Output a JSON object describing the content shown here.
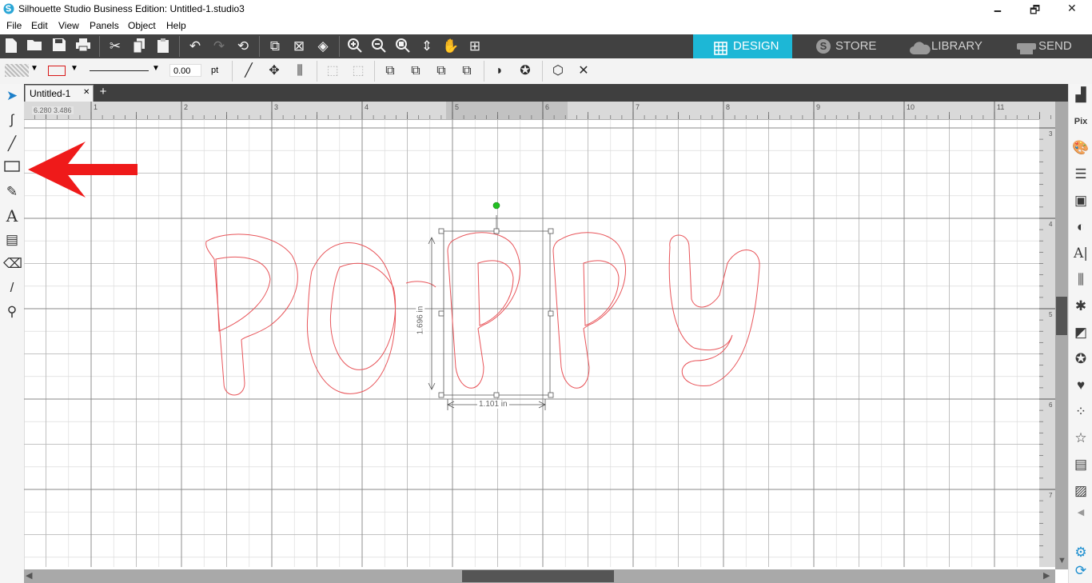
{
  "window": {
    "title": "Silhouette Studio Business Edition: Untitled-1.studio3",
    "minimize": "🗕",
    "restore": "🗗",
    "close": "✕"
  },
  "menu": [
    "File",
    "Edit",
    "View",
    "Panels",
    "Object",
    "Help"
  ],
  "toolbar": {
    "icons": [
      "new-file-icon",
      "open-folder-icon",
      "save-icon",
      "print-icon",
      "cut-icon",
      "copy-icon",
      "paste-icon",
      "undo-icon",
      "redo-icon",
      "redraw-icon",
      "select-all-icon",
      "deselect-icon",
      "select-by-color-icon",
      "zoom-in-icon",
      "zoom-out-icon",
      "zoom-selected-icon",
      "pan-fit-icon",
      "hand-pan-icon",
      "fit-to-page-icon"
    ]
  },
  "nav_tabs": [
    {
      "label": "DESIGN",
      "icon": "grid-icon",
      "active": true
    },
    {
      "label": "STORE",
      "icon": "silhouette-s-icon",
      "active": false
    },
    {
      "label": "LIBRARY",
      "icon": "cloud-icon",
      "active": false
    },
    {
      "label": "SEND",
      "icon": "cutter-icon",
      "active": false
    }
  ],
  "line_settings": {
    "line_width": "0.00",
    "unit": "pt"
  },
  "document_tab": {
    "name": "Untitled-1",
    "close": "✕",
    "add": "+"
  },
  "ruler": {
    "cursor_readout": "6.280 3.486",
    "h_labels": [
      "1",
      "2",
      "3",
      "4",
      "5",
      "6",
      "7",
      "8",
      "9",
      "10",
      "11"
    ],
    "v_labels": [
      "3",
      "4",
      "5",
      "6",
      "7"
    ]
  },
  "design": {
    "text": "Poppy",
    "outline_color": "#e8555a",
    "height_label": "1.696 in",
    "width_label": "1.101 in",
    "rotate_handle_color": "#21c021"
  },
  "annotation": {
    "arrow_color": "#ef1a1a"
  },
  "left_tools": [
    "select-arrow-icon",
    "bezier-curve-icon",
    "line-icon",
    "rectangle-icon",
    "pencil-icon",
    "text-icon",
    "eraser-block-icon",
    "eraser-icon",
    "knife-icon",
    "eyedropper-icon"
  ],
  "right_panel": [
    "page-setup-icon",
    "pixscan-icon",
    "fill-color-icon",
    "line-style-icon",
    "layers-icon",
    "half-tone-icon",
    "text-style-icon",
    "align-icon",
    "replicate-icon",
    "modify-icon",
    "offset-icon",
    "trace-icon",
    "sketch-icon",
    "star-icon",
    "library-icon",
    "point-icon",
    "settings-icon",
    "refresh-icon"
  ]
}
